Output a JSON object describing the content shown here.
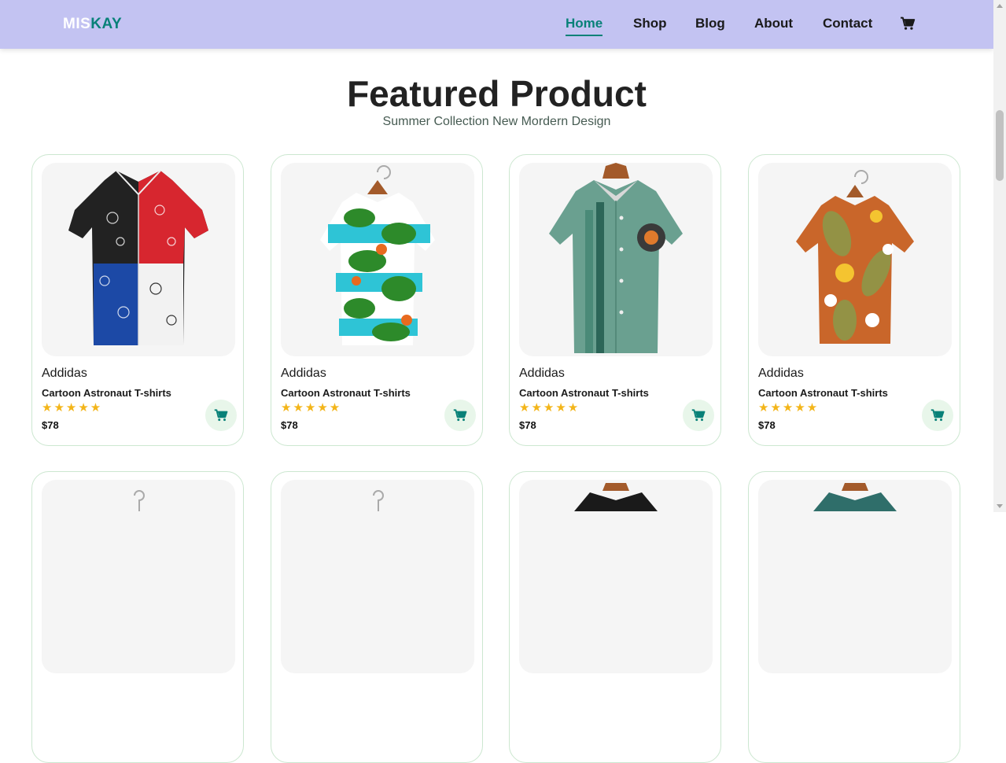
{
  "header": {
    "logo_part1": "MIS",
    "logo_part2": "KAY",
    "nav": [
      {
        "label": "Home",
        "active": true
      },
      {
        "label": "Shop"
      },
      {
        "label": "Blog"
      },
      {
        "label": "About"
      },
      {
        "label": "Contact"
      }
    ],
    "cart_icon": "cart-icon"
  },
  "section": {
    "title": "Featured Product",
    "subtitle": "Summer Collection New Mordern Design"
  },
  "products": [
    {
      "brand": "Addidas",
      "name": "Cartoon Astronaut T-shirts",
      "stars": "★★★★★",
      "rating": 5,
      "price": "$78",
      "image": "paisley-patchwork-shirt"
    },
    {
      "brand": "Addidas",
      "name": "Cartoon Astronaut T-shirts",
      "stars": "★★★★★",
      "rating": 5,
      "price": "$78",
      "image": "tropical-leaf-shirt"
    },
    {
      "brand": "Addidas",
      "name": "Cartoon Astronaut T-shirts",
      "stars": "★★★★★",
      "rating": 5,
      "price": "$78",
      "image": "green-bowling-shirt"
    },
    {
      "brand": "Addidas",
      "name": "Cartoon Astronaut T-shirts",
      "stars": "★★★★★",
      "rating": 5,
      "price": "$78",
      "image": "orange-floral-shirt"
    }
  ],
  "colors": {
    "accent": "#088178",
    "header_bg": "#c3c3f2",
    "star": "#f3b519",
    "cart_bg": "#e8f6ea",
    "card_border": "#cce7d0"
  }
}
